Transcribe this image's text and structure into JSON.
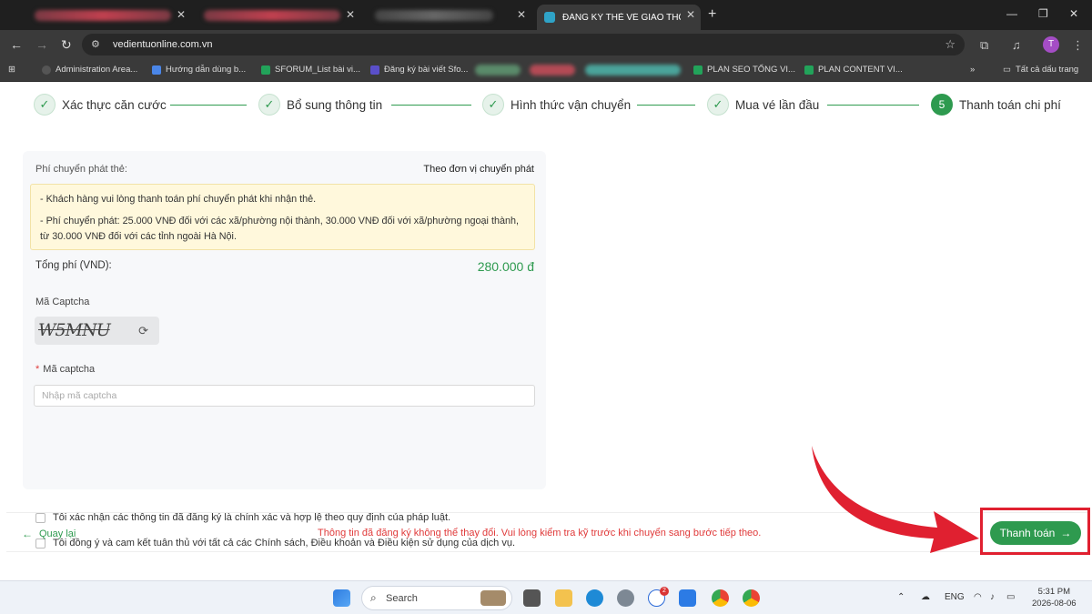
{
  "browser": {
    "active_tab_title": "ĐĂNG KÝ THẺ VÉ GIAO THÔNG",
    "url": "vedientuonline.com.vn",
    "bookmarks": [
      {
        "label": "Administration Area..."
      },
      {
        "label": "Hướng dẫn dùng b..."
      },
      {
        "label": "SFORUM_List bài vi..."
      },
      {
        "label": "Đăng ký bài viết Sfo..."
      },
      {
        "label": "PLAN SEO TỔNG VI..."
      },
      {
        "label": "PLAN CONTENT VI..."
      }
    ],
    "all_bookmarks": "Tất cả dấu trang",
    "profile_initial": "T"
  },
  "stepper": {
    "steps": [
      {
        "label": "Xác thực căn cước"
      },
      {
        "label": "Bổ sung thông tin"
      },
      {
        "label": "Hình thức vận chuyển"
      },
      {
        "label": "Mua vé lần đầu"
      },
      {
        "label": "Thanh toán chi phí",
        "number": "5"
      }
    ]
  },
  "payment": {
    "fee_label": "Phí chuyển phát thẻ:",
    "fee_value": "Theo đơn vị chuyển phát",
    "notice_lines": [
      "- Khách hàng vui lòng thanh toán phí chuyển phát khi nhận thẻ.",
      "- Phí chuyển phát: 25.000 VNĐ đối với các xã/phường nội thành, 30.000 VNĐ đối với xã/phường ngoại thành, từ 30.000 VNĐ đối với các tỉnh ngoài Hà Nội."
    ],
    "total_label": "Tổng phí (VND):",
    "total_value": "280.000 đ",
    "captcha_title": "Mã Captcha",
    "captcha_image_text": "W5MNU",
    "captcha_field_label": "Mã captcha",
    "captcha_placeholder": "Nhập mã captcha",
    "confirm_1": "Tôi xác nhận các thông tin đã đăng ký là chính xác và hợp lệ theo quy định của pháp luật.",
    "confirm_2": "Tôi đồng ý và cam kết tuân thủ với tất cả các Chính sách, Điều khoản và Điều kiện sử dụng của dịch vụ."
  },
  "footer": {
    "back_label": "Quay lại",
    "warning": "Thông tin đã đăng ký không thể thay đổi. Vui lòng kiểm tra kỹ trước khi chuyển sang bước tiếp theo.",
    "pay_label": "Thanh toán"
  },
  "taskbar": {
    "search_label": "Search",
    "lang": "ENG",
    "time": "5:31 PM",
    "date": "2026-08-06",
    "zalo_badge": "2"
  },
  "colors": {
    "accent": "#2e9a4f",
    "warning": "#e03a3a",
    "highlight": "#e02030"
  }
}
